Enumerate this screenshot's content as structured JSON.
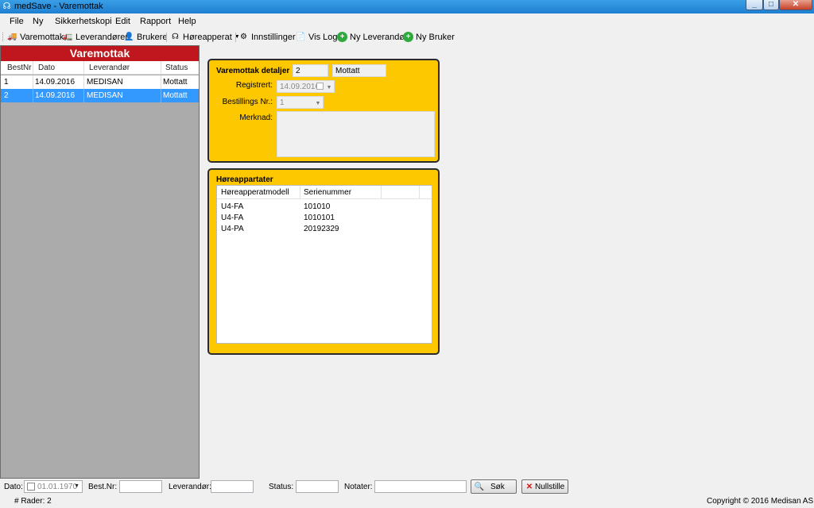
{
  "window": {
    "title": "medSave - Varemottak",
    "min": "_",
    "max": "□",
    "close": "✕"
  },
  "menu": [
    "File",
    "Ny",
    "Sikkerhetskopi",
    "Edit",
    "Rapport",
    "Help"
  ],
  "toolbar": {
    "varemottak": "Varemottak",
    "leverandorer": "Leverandører",
    "brukere": "Brukere",
    "horeapparat": "Høreapperat",
    "innstillinger": "Innstillinger",
    "vislog": "Vis Log",
    "nyleverandor": "Ny Leverandør",
    "nybruker": "Ny Bruker"
  },
  "left": {
    "title": "Varemottak",
    "columns": [
      "BestNr",
      "Dato",
      "Leverandør",
      "Status"
    ],
    "rows": [
      {
        "bestnr": "1",
        "dato": "14.09.2016",
        "leverandor": "MEDISAN",
        "status": "Mottatt",
        "selected": false
      },
      {
        "bestnr": "2",
        "dato": "14.09.2016",
        "leverandor": "MEDISAN",
        "status": "Mottatt",
        "selected": true
      }
    ]
  },
  "details": {
    "title": "Varemottak detaljer",
    "nr_value": "2",
    "status_value": "Mottatt",
    "registrert_label": "Registrert:",
    "registrert_value": "14.09.2016",
    "bestillings_label": "Bestillings Nr.:",
    "bestillings_value": "1",
    "merknad_label": "Merknad:",
    "merknad_value": ""
  },
  "devices": {
    "title": "Høreappartater",
    "columns": [
      "Høreapperatmodell",
      "Serienummer"
    ],
    "rows": [
      {
        "model": "U4-FA",
        "serial": "101010"
      },
      {
        "model": "U4-FA",
        "serial": "1010101"
      },
      {
        "model": "U4-PA",
        "serial": "20192329"
      }
    ]
  },
  "filter": {
    "dato_label": "Dato:",
    "dato_value": "01.01.1970",
    "bestnr_label": "Best.Nr:",
    "leverandor_label": "Leverandør:",
    "status_label": "Status:",
    "notater_label": "Notater:",
    "sok_label": "Søk",
    "nullstille_label": "Nullstille"
  },
  "status": {
    "rows_text": "# Rader: 2",
    "copyright": "Copyright © 2016 Medisan AS"
  },
  "colors": {
    "accent_red": "#c0161d",
    "panel_yellow": "#fdc800",
    "selection_blue": "#3399ff"
  }
}
